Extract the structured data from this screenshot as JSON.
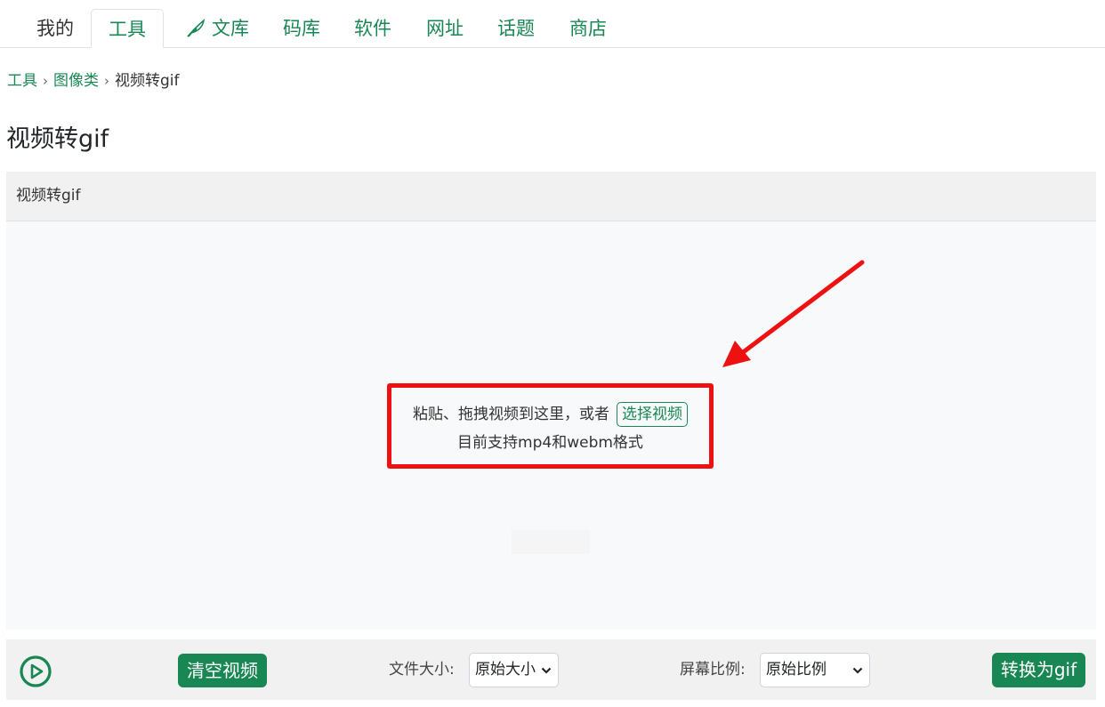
{
  "nav": {
    "items": [
      {
        "label": "我的"
      },
      {
        "label": "工具"
      },
      {
        "label": "文库"
      },
      {
        "label": "码库"
      },
      {
        "label": "软件"
      },
      {
        "label": "网址"
      },
      {
        "label": "话题"
      },
      {
        "label": "商店"
      }
    ],
    "active": "工具"
  },
  "breadcrumb": {
    "items": [
      "工具",
      "图像类",
      "视频转gif"
    ],
    "separator": "›"
  },
  "page_title": "视频转gif",
  "card": {
    "header": "视频转gif",
    "drop_text": "粘贴、拖拽视频到这里，或者",
    "select_button": "选择视频",
    "support_text": "目前支持mp4和webm格式"
  },
  "toolbar": {
    "clear_button": "清空视频",
    "file_size_label": "文件大小:",
    "file_size_value": "原始大小",
    "ratio_label": "屏幕比例:",
    "ratio_value": "原始比例",
    "convert_button": "转换为gif"
  },
  "colors": {
    "accent": "#198754",
    "annotation": "#ee1111"
  },
  "icons": {
    "wenku": "feather-pen-icon",
    "play": "play-circle-icon",
    "dropdown": "chevron-down-icon",
    "annotation": "red-arrow-icon"
  }
}
